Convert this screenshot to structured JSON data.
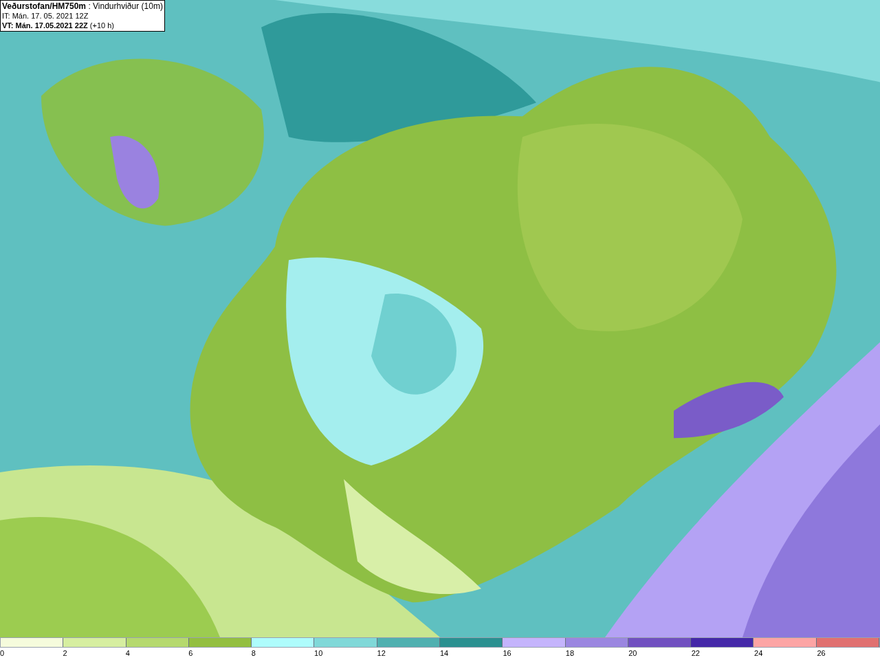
{
  "header": {
    "lines": [
      "**Veðurstofan/HM750m** : Vindurhviður (10m)",
      "IT: Mán. 17. 05. 2021 12Z",
      "**VT: Mán. 17.05.2021 22Z** (+10 h)"
    ]
  },
  "legend": [
    {
      "label": "0",
      "color": "#f5fbdc"
    },
    {
      "label": "2",
      "color": "#d6eea0"
    },
    {
      "label": "4",
      "color": "#b5d96e"
    },
    {
      "label": "6",
      "color": "#93bf40"
    },
    {
      "label": "8",
      "color": "#aefcfc"
    },
    {
      "label": "10",
      "color": "#80d8d8"
    },
    {
      "label": "12",
      "color": "#50b0b0"
    },
    {
      "label": "14",
      "color": "#2a9090"
    },
    {
      "label": "16",
      "color": "#c4b4fc"
    },
    {
      "label": "18",
      "color": "#9a86e0"
    },
    {
      "label": "20",
      "color": "#7050c0"
    },
    {
      "label": "22",
      "color": "#4428a8"
    },
    {
      "label": "24",
      "color": "#fca4a4"
    },
    {
      "label": "26",
      "color": "#e07070"
    }
  ]
}
